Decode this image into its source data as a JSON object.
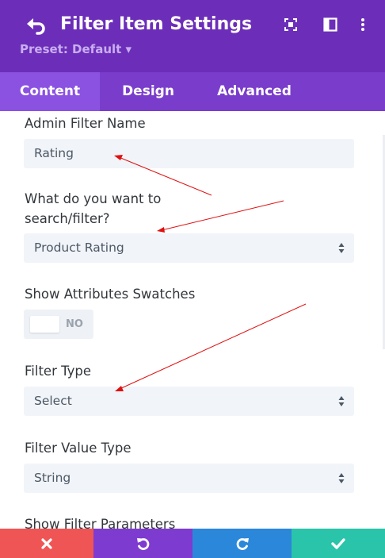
{
  "header": {
    "title": "Filter Item Settings",
    "preset": "Preset: Default ▾",
    "color": "#6c2eb9"
  },
  "tabs": [
    {
      "label": "Content",
      "active": true
    },
    {
      "label": "Design",
      "active": false
    },
    {
      "label": "Advanced",
      "active": false
    }
  ],
  "fields": {
    "admin_filter_name": {
      "label": "Admin Filter Name",
      "value": "Rating"
    },
    "search_filter": {
      "label_line1": "What do you want to",
      "label_line2": "search/filter?",
      "value": "Product Rating"
    },
    "swatches": {
      "label": "Show Attributes Swatches",
      "toggle_text": "NO",
      "enabled": false
    },
    "filter_type": {
      "label": "Filter Type",
      "value": "Select"
    },
    "filter_value_type": {
      "label": "Filter Value Type",
      "value": "String"
    },
    "filter_parameters": {
      "label": "Show Filter Parameters"
    }
  },
  "footer": {
    "buttons": [
      {
        "name": "discard",
        "icon": "close-icon",
        "color": "#ef5555"
      },
      {
        "name": "undo",
        "icon": "undo-icon",
        "color": "#7e3bd0"
      },
      {
        "name": "redo",
        "icon": "redo-icon",
        "color": "#2b87da"
      },
      {
        "name": "save",
        "icon": "check-icon",
        "color": "#29c4a9"
      }
    ]
  },
  "annotation_color": "#e01010"
}
